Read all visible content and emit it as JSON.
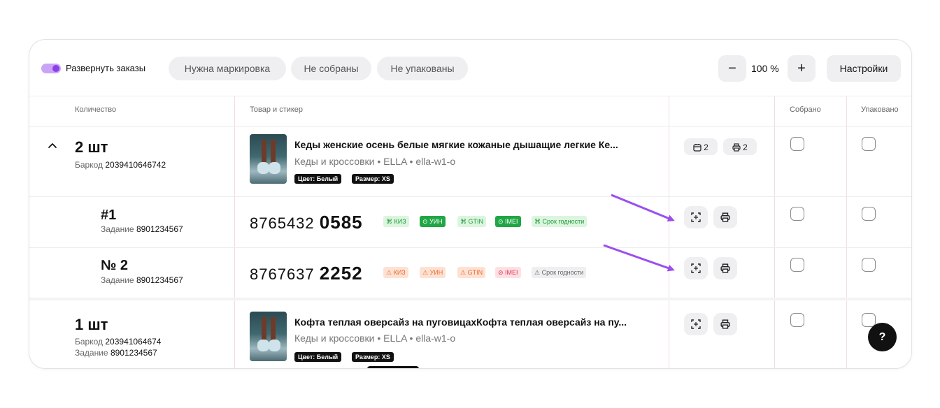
{
  "toolbar": {
    "expand_label": "Развернуть заказы",
    "filters": [
      "Нужна маркировка",
      "Не собраны",
      "Не упакованы"
    ],
    "zoom_minus": "−",
    "zoom_value": "100 %",
    "zoom_plus": "+",
    "settings_label": "Настройки",
    "accent": "#8b3fe6"
  },
  "columns": [
    "Количество",
    "Товар и стикер",
    "Собрано",
    "Упаковано"
  ],
  "group1": {
    "qty": "2 шт",
    "barcode_label": "Баркод",
    "barcode": "2039410646742",
    "product_name": "Кеды женские осень белые мягкие кожаные дышащие легкие Ке...",
    "product_meta": "Кеды и кроссовки • ELLA • ella-w1-o",
    "tags": [
      "Цвет: Белый",
      "Размер: XS"
    ],
    "calendar_count": "2",
    "print_count": "2"
  },
  "items": [
    {
      "num": "#1",
      "task_label": "Задание",
      "task": "8901234567",
      "code_prefix": "8765432",
      "code_suffix": "0585",
      "badges": [
        "КИЗ",
        "УИН",
        "GTIN",
        "IMEI",
        "Срок годности"
      ]
    },
    {
      "num": "№ 2",
      "task_label": "Задание",
      "task": "8901234567",
      "code_prefix": "8767637",
      "code_suffix": "2252",
      "badges": [
        "КИЗ",
        "УИН",
        "GTIN",
        "IMEI",
        "Срок годности"
      ]
    }
  ],
  "group2": {
    "qty": "1 шт",
    "barcode_label": "Баркод",
    "barcode": "203941064674",
    "task_label": "Задание",
    "task": "8901234567",
    "product_name": "Кофта теплая оверсайз на пуговицахКофта теплая оверсайз на пу...",
    "product_meta": "Кеды и кроссовки • ELLA • ella-w1-o",
    "tags": [
      "Цвет: Белый",
      "Размер: XS"
    ]
  },
  "help_label": "?",
  "colors": {
    "green": "#1f9a3a",
    "orange": "#ea6a2c",
    "red": "#e23654",
    "arrow": "#9b4ef0"
  }
}
